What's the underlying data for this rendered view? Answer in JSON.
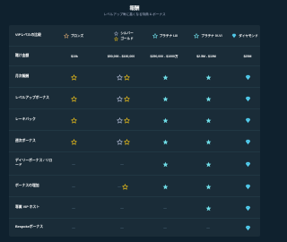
{
  "header": {
    "title": "報酬",
    "subtitle": "レベルアップ毎に高くなる特典 & ボーナス"
  },
  "table": {
    "row_labels": {
      "level": "VIPレベルの比較",
      "wager": "賭け金額",
      "weekly": "月次報酬",
      "levelup": "レベルアップボーナス",
      "rakeback": "レーキバック",
      "monthly": "週次ボーナス",
      "daily": "デイリーボーナス / リロード",
      "increase": "ボーナスの増加",
      "host": "専属 VIP ホスト",
      "bespoke": "Bespokeボーナス"
    },
    "tiers": {
      "bronze": "ブロンズ",
      "silver": "シルバー",
      "gold": "ゴールド",
      "platinum": "プラチナ I-III",
      "platinum2": "プラチナ IV-VI",
      "diamond": "ダイヤモンド"
    },
    "wager": {
      "bronze": "$10k",
      "silver_gold": "$50,000 - $100,000",
      "platinum": "$250,000 - $1000万",
      "platinum2": "$2.5M - $10M",
      "diamond": "$25M"
    },
    "dash": "—",
    "colors": {
      "bronze": "#c69c6d",
      "gold": "#f5c518",
      "silver": "#b1bad3",
      "platinum": "#6fdde7",
      "diamond": "#5fd7f5"
    },
    "icons": {
      "star": "star-outline-icon",
      "diamond": "diamond-icon"
    }
  }
}
